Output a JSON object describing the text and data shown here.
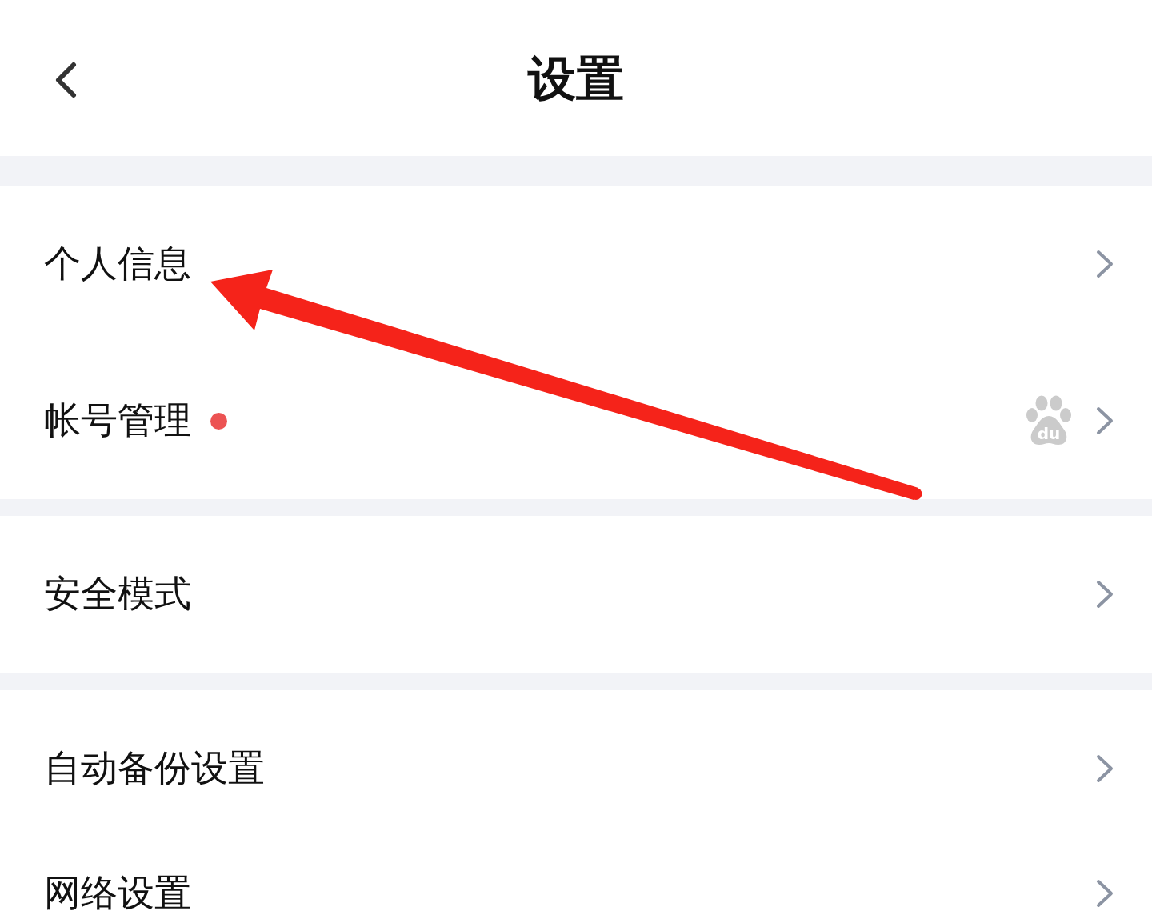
{
  "header": {
    "title": "设置"
  },
  "groups": [
    {
      "items": [
        {
          "label": "个人信息",
          "badge_dot": false
        },
        {
          "label": "帐号管理",
          "badge_dot": true,
          "logo_text": "du"
        }
      ]
    },
    {
      "items": [
        {
          "label": "安全模式",
          "badge_dot": false
        }
      ]
    },
    {
      "items": [
        {
          "label": "自动备份设置",
          "badge_dot": false
        },
        {
          "label": "网络设置",
          "badge_dot": false
        }
      ]
    }
  ]
}
